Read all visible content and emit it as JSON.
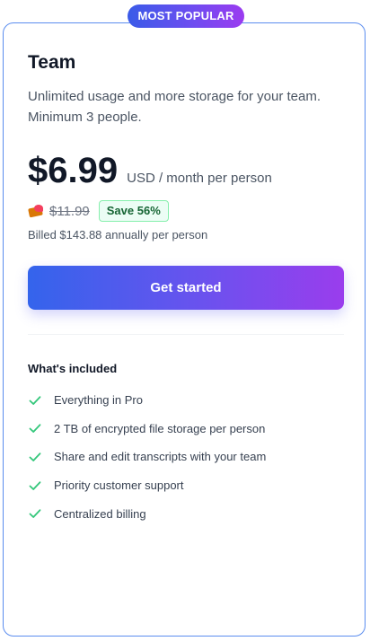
{
  "badge": "MOST POPULAR",
  "plan": {
    "name": "Team",
    "description": "Unlimited usage and more storage for your team. Minimum 3 people."
  },
  "pricing": {
    "price": "$6.99",
    "unit": "USD / month per person",
    "old_price": "$11.99",
    "save": "Save 56%",
    "billed": "Billed $143.88 annually per person"
  },
  "cta": "Get started",
  "included": {
    "title": "What's included",
    "items": [
      "Everything in Pro",
      "2 TB of encrypted file storage per person",
      "Share and edit transcripts with your team",
      "Priority customer support",
      "Centralized billing"
    ]
  },
  "colors": {
    "border": "#5b8def",
    "gradient_start": "#3464ec",
    "gradient_end": "#9a3ded",
    "check": "#34c77b",
    "save_bg": "#ecfdf5",
    "save_text": "#166534"
  },
  "icons": {
    "money": "money-with-wings-icon",
    "check": "check-icon"
  }
}
